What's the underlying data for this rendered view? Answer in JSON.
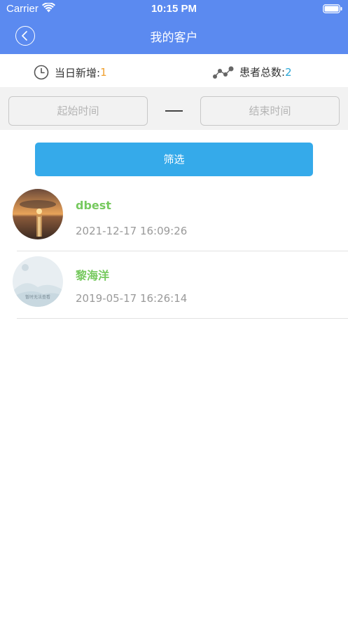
{
  "status_bar": {
    "carrier": "Carrier",
    "time": "10:15 PM",
    "icons": [
      "wifi-icon",
      "battery-icon"
    ]
  },
  "nav": {
    "title": "我的客户",
    "back_icon": "chevron-left-icon"
  },
  "stats": {
    "daily_new_label": "当日新增:",
    "daily_new_value": "1",
    "total_patients_label": "患者总数:",
    "total_patients_value": "2",
    "icons": [
      "clock-icon",
      "trend-icon"
    ]
  },
  "date_filter": {
    "start_placeholder": "起始时间",
    "end_placeholder": "结束时间",
    "separator": "—"
  },
  "filter_button": {
    "label": "筛选"
  },
  "customers": [
    {
      "name": "dbest",
      "time": "2021-12-17 16:09:26",
      "avatar": "sunset-photo"
    },
    {
      "name": "黎海洋",
      "time": "2019-05-17 16:26:14",
      "avatar": "placeholder-image",
      "avatar_text": "暂时无法查看"
    }
  ],
  "colors": {
    "header": "#5b8af0",
    "button": "#35aaea",
    "name_green": "#76c95e",
    "daily_value": "#f0a030",
    "total_value": "#2aa6d6"
  }
}
